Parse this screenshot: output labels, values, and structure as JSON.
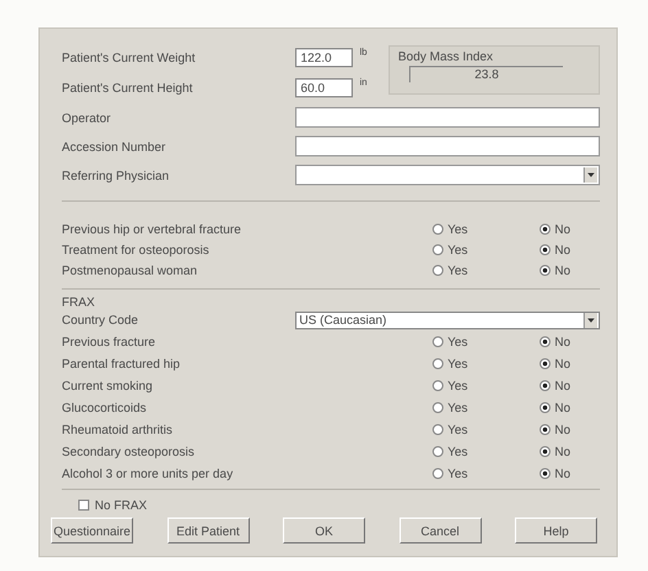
{
  "measurements": [
    {
      "label": "Patient's Current Weight",
      "value": "122.0",
      "unit": "lb"
    },
    {
      "label": "Patient's Current Height",
      "value": "60.0",
      "unit": "in"
    }
  ],
  "bmi": {
    "title": "Body Mass Index",
    "value": "23.8"
  },
  "fields": [
    {
      "label": "Operator",
      "kind": "text"
    },
    {
      "label": "Accession Number",
      "kind": "text"
    },
    {
      "label": "Referring Physician",
      "kind": "dropdown"
    }
  ],
  "risk_questions": [
    {
      "label": "Previous hip or vertebral fracture",
      "options": [
        {
          "label": "Yes",
          "selected": false
        },
        {
          "label": "No",
          "selected": true
        }
      ]
    },
    {
      "label": "Treatment for osteoporosis",
      "options": [
        {
          "label": "Yes",
          "selected": false
        },
        {
          "label": "No",
          "selected": true
        }
      ]
    },
    {
      "label": "Postmenopausal woman",
      "options": [
        {
          "label": "Yes",
          "selected": false
        },
        {
          "label": "No",
          "selected": true
        }
      ]
    }
  ],
  "frax": {
    "title": "FRAX",
    "country_code": {
      "label": "Country Code",
      "value": "US (Caucasian)"
    },
    "questions": [
      {
        "label": "Previous fracture",
        "options": [
          {
            "label": "Yes",
            "selected": false
          },
          {
            "label": "No",
            "selected": true
          }
        ]
      },
      {
        "label": "Parental fractured hip",
        "options": [
          {
            "label": "Yes",
            "selected": false
          },
          {
            "label": "No",
            "selected": true
          }
        ]
      },
      {
        "label": "Current smoking",
        "options": [
          {
            "label": "Yes",
            "selected": false
          },
          {
            "label": "No",
            "selected": true
          }
        ]
      },
      {
        "label": "Glucocorticoids",
        "options": [
          {
            "label": "Yes",
            "selected": false
          },
          {
            "label": "No",
            "selected": true
          }
        ]
      },
      {
        "label": "Rheumatoid arthritis",
        "options": [
          {
            "label": "Yes",
            "selected": false
          },
          {
            "label": "No",
            "selected": true
          }
        ]
      },
      {
        "label": "Secondary osteoporosis",
        "options": [
          {
            "label": "Yes",
            "selected": false
          },
          {
            "label": "No",
            "selected": true
          }
        ]
      },
      {
        "label": "Alcohol 3 or more units per day",
        "options": [
          {
            "label": "Yes",
            "selected": false
          },
          {
            "label": "No",
            "selected": true
          }
        ]
      }
    ]
  },
  "no_frax": {
    "label": "No FRAX",
    "checked": false
  },
  "buttons": [
    "Questionnaire",
    "Edit Patient",
    "OK",
    "Cancel",
    "Help"
  ]
}
